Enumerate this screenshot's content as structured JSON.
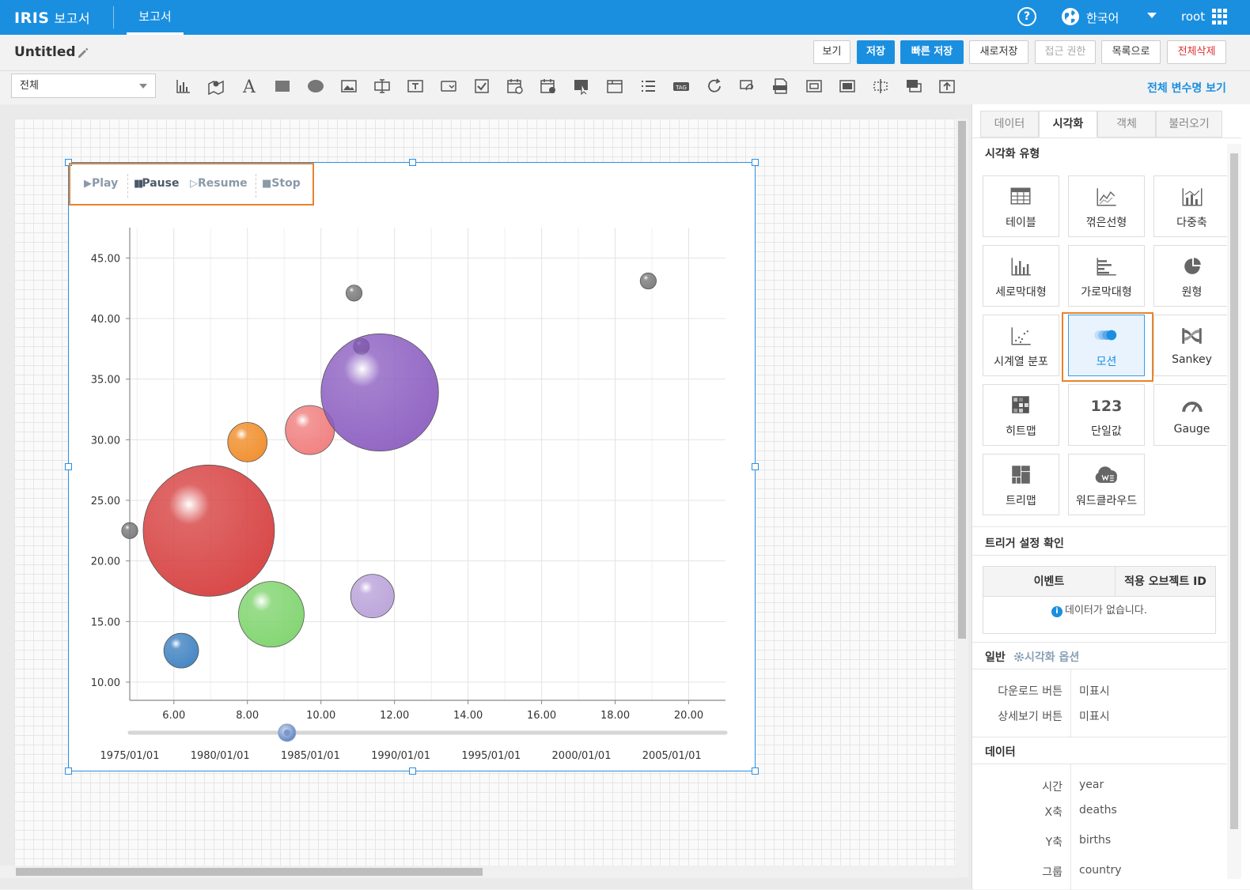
{
  "topbar": {
    "brand": "IRIS",
    "brand_sub": "보고서",
    "tab": "보고서",
    "help_icon_glyph": "?",
    "language": "한국어",
    "user": "root"
  },
  "titlebar": {
    "title": "Untitled",
    "buttons": {
      "view": "보기",
      "save": "저장",
      "quick_save": "빠른 저장",
      "save_as": "새로저장",
      "access": "접근 권한",
      "list": "목록으로",
      "delete_all": "전체삭제"
    }
  },
  "toolbar": {
    "filter_value": "전체",
    "all_vars_link": "전체 변수명 보기"
  },
  "playbar": {
    "play": "Play",
    "pause": "Pause",
    "resume": "Resume",
    "stop": "Stop"
  },
  "chart_data": {
    "type": "scatter",
    "subtype": "motion bubble",
    "x_ticks": [
      "6.00",
      "8.00",
      "10.00",
      "12.00",
      "14.00",
      "16.00",
      "18.00",
      "20.00"
    ],
    "y_ticks": [
      "10.00",
      "15.00",
      "20.00",
      "25.00",
      "30.00",
      "35.00",
      "40.00",
      "45.00"
    ],
    "xlim": [
      4.8,
      21.0
    ],
    "ylim": [
      8.5,
      47.5
    ],
    "grid": true,
    "points": [
      {
        "x": 4.8,
        "y": 22.5,
        "size": 0.015,
        "color": "#777777"
      },
      {
        "x": 6.95,
        "y": 22.5,
        "size": 1.0,
        "color": "#d63c3c"
      },
      {
        "x": 6.2,
        "y": 12.6,
        "size": 0.07,
        "color": "#3a7fc0"
      },
      {
        "x": 8.0,
        "y": 29.8,
        "size": 0.09,
        "color": "#f08a24"
      },
      {
        "x": 8.65,
        "y": 15.6,
        "size": 0.25,
        "color": "#7cd36a"
      },
      {
        "x": 9.7,
        "y": 30.8,
        "size": 0.14,
        "color": "#f07a7a"
      },
      {
        "x": 10.9,
        "y": 42.1,
        "size": 0.015,
        "color": "#777777"
      },
      {
        "x": 11.1,
        "y": 37.7,
        "size": 0.015,
        "color": "#555555"
      },
      {
        "x": 11.6,
        "y": 33.9,
        "size": 0.8,
        "color": "#8a5cc0"
      },
      {
        "x": 11.4,
        "y": 17.1,
        "size": 0.11,
        "color": "#b8a0d8"
      },
      {
        "x": 18.9,
        "y": 43.1,
        "size": 0.015,
        "color": "#777777"
      }
    ],
    "timeline": {
      "labels": [
        "1975/01/01",
        "1980/01/01",
        "1985/01/01",
        "1990/01/01",
        "1995/01/01",
        "2000/01/01",
        "2005/01/01"
      ],
      "current_position": 0.264
    }
  },
  "sidebar": {
    "tabs": [
      "데이터",
      "시각화",
      "객체",
      "불러오기"
    ],
    "active_tab": "시각화",
    "viz_section_title": "시각화 유형",
    "viz_types": [
      "테이블",
      "꺾은선형",
      "다중축",
      "세로막대형",
      "가로막대형",
      "원형",
      "시계열 분포",
      "모션",
      "Sankey",
      "히트맵",
      "단일값",
      "Gauge",
      "트리맵",
      "워드클라우드"
    ],
    "single_value_icon_text": "123",
    "selected_viz": "모션",
    "trigger_title": "트리거 설정 확인",
    "trigger_headers": [
      "이벤트",
      "적용 오브젝트 ID"
    ],
    "trigger_empty": "데이터가 없습니다.",
    "general_title": "일반",
    "viz_options_link": "시각화 옵션",
    "general_rows": [
      {
        "label": "다운로드 버튼",
        "value": "미표시"
      },
      {
        "label": "상세보기 버튼",
        "value": "미표시"
      }
    ],
    "data_title": "데이터",
    "data_rows": [
      {
        "label": "시간",
        "value": "year"
      },
      {
        "label": "X축",
        "value": "deaths"
      },
      {
        "label": "Y축",
        "value": "births"
      },
      {
        "label": "그룹",
        "value": "country"
      }
    ]
  }
}
